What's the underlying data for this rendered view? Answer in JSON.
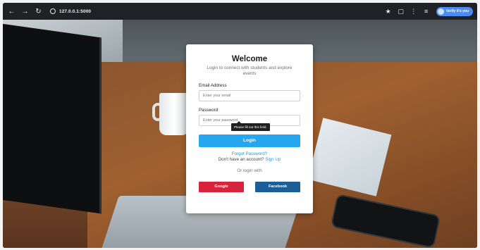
{
  "browser": {
    "url": "127.0.0.1:5000",
    "profile_chip": "Verify it's you",
    "icons": [
      "back-arrow-icon",
      "forward-arrow-icon",
      "reload-icon",
      "site-info-icon",
      "star-icon",
      "extensions-icon",
      "menu-icon"
    ]
  },
  "login": {
    "title": "Welcome",
    "subtitle": "Login to connect with students and explore events",
    "email_label": "Email Address",
    "email_placeholder": "Enter your email",
    "tooltip": "Please fill out this field.",
    "password_label": "Password",
    "password_placeholder": "Enter your password",
    "login_button": "Login",
    "forgot_password": "Forgot Password?",
    "no_account_text": "Don't have an account?",
    "sign_up": "Sign Up",
    "or_login_with": "Or login with",
    "google_button": "Google",
    "facebook_button": "Facebook"
  },
  "colors": {
    "primary": "#26a6ee",
    "link": "#1a9bd7",
    "google": "#d8233c",
    "facebook": "#1c5f98"
  }
}
